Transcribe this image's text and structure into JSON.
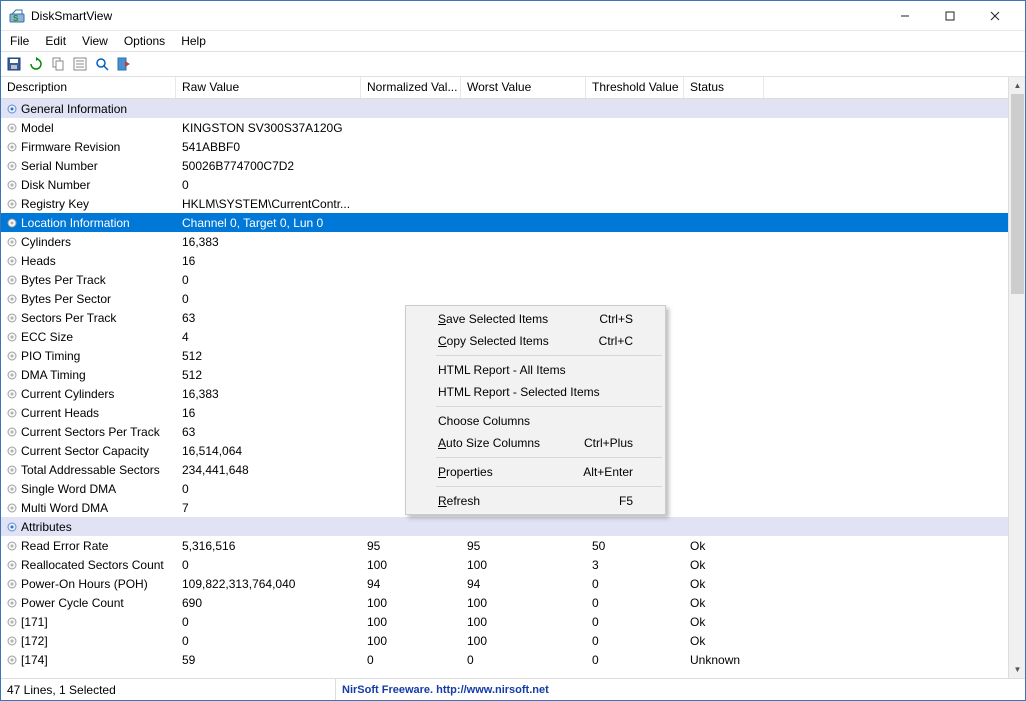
{
  "window": {
    "title": "DiskSmartView"
  },
  "menubar": [
    "File",
    "Edit",
    "View",
    "Options",
    "Help"
  ],
  "columns": [
    "Description",
    "Raw Value",
    "Normalized Val...",
    "Worst Value",
    "Threshold Value",
    "Status"
  ],
  "rows": [
    {
      "type": "section",
      "desc": "General Information"
    },
    {
      "desc": "Model",
      "raw": "KINGSTON SV300S37A120G"
    },
    {
      "desc": "Firmware Revision",
      "raw": "541ABBF0"
    },
    {
      "desc": "Serial Number",
      "raw": "50026B774700C7D2"
    },
    {
      "desc": "Disk Number",
      "raw": "0"
    },
    {
      "desc": "Registry Key",
      "raw": "HKLM\\SYSTEM\\CurrentContr..."
    },
    {
      "desc": "Location Information",
      "raw": "Channel 0, Target 0, Lun 0",
      "selected": true
    },
    {
      "desc": "Cylinders",
      "raw": "16,383"
    },
    {
      "desc": "Heads",
      "raw": "16"
    },
    {
      "desc": "Bytes Per Track",
      "raw": "0"
    },
    {
      "desc": "Bytes Per Sector",
      "raw": "0"
    },
    {
      "desc": "Sectors Per Track",
      "raw": "63"
    },
    {
      "desc": "ECC Size",
      "raw": "4"
    },
    {
      "desc": "PIO Timing",
      "raw": "512"
    },
    {
      "desc": "DMA Timing",
      "raw": "512"
    },
    {
      "desc": "Current Cylinders",
      "raw": "16,383"
    },
    {
      "desc": "Current Heads",
      "raw": "16"
    },
    {
      "desc": "Current Sectors Per Track",
      "raw": "63"
    },
    {
      "desc": "Current Sector Capacity",
      "raw": "16,514,064"
    },
    {
      "desc": "Total Addressable Sectors",
      "raw": "234,441,648"
    },
    {
      "desc": "Single Word DMA",
      "raw": "0"
    },
    {
      "desc": "Multi Word DMA",
      "raw": "7"
    },
    {
      "type": "section",
      "desc": "Attributes"
    },
    {
      "desc": "Read Error Rate",
      "raw": "5,316,516",
      "norm": "95",
      "worst": "95",
      "thresh": "50",
      "status": "Ok"
    },
    {
      "desc": "Reallocated Sectors Count",
      "raw": "0",
      "norm": "100",
      "worst": "100",
      "thresh": "3",
      "status": "Ok"
    },
    {
      "desc": "Power-On Hours (POH)",
      "raw": "109,822,313,764,040",
      "norm": "94",
      "worst": "94",
      "thresh": "0",
      "status": "Ok"
    },
    {
      "desc": "Power Cycle Count",
      "raw": "690",
      "norm": "100",
      "worst": "100",
      "thresh": "0",
      "status": "Ok"
    },
    {
      "desc": "[171]",
      "raw": "0",
      "norm": "100",
      "worst": "100",
      "thresh": "0",
      "status": "Ok"
    },
    {
      "desc": "[172]",
      "raw": "0",
      "norm": "100",
      "worst": "100",
      "thresh": "0",
      "status": "Ok"
    },
    {
      "desc": "[174]",
      "raw": "59",
      "norm": "0",
      "worst": "0",
      "thresh": "0",
      "status": "Unknown"
    }
  ],
  "context_menu": [
    {
      "label": "Save Selected Items",
      "shortcut": "Ctrl+S",
      "u": "S"
    },
    {
      "label": "Copy Selected Items",
      "shortcut": "Ctrl+C",
      "u": "C"
    },
    {
      "sep": true
    },
    {
      "label": "HTML Report - All Items"
    },
    {
      "label": "HTML Report - Selected Items"
    },
    {
      "sep": true
    },
    {
      "label": "Choose Columns"
    },
    {
      "label": "Auto Size Columns",
      "shortcut": "Ctrl+Plus",
      "u": "A"
    },
    {
      "sep": true
    },
    {
      "label": "Properties",
      "shortcut": "Alt+Enter",
      "u": "P"
    },
    {
      "sep": true
    },
    {
      "label": "Refresh",
      "shortcut": "F5",
      "u": "R"
    }
  ],
  "statusbar": {
    "left": "47 Lines, 1 Selected",
    "center": "NirSoft Freeware.  http://www.nirsoft.net"
  }
}
